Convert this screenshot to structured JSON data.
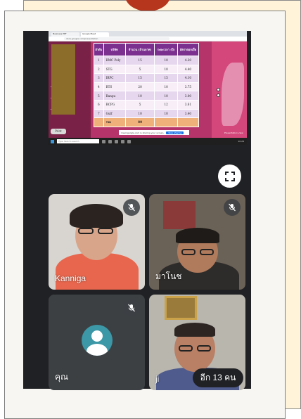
{
  "browser": {
    "tabs": [
      "Business PPT",
      "Google Meet"
    ],
    "url": "docs.google.com/presentation"
  },
  "slide": {
    "left_lines": [
      "...",
      "...",
      "..."
    ],
    "print_button": "Print",
    "table": {
      "headers": [
        "ลำดับ",
        "บริษัท",
        "จำนวน (ล้านบาท)",
        "ระยะเวลา (ปี)",
        "อัตราดอกเบี้ย"
      ],
      "rows": [
        [
          "1",
          "RMC Poly",
          "15",
          "10",
          "4.20"
        ],
        [
          "2",
          "STG",
          "5",
          "10",
          "4.40"
        ],
        [
          "3",
          "IRPC",
          "15",
          "15",
          "4.10"
        ],
        [
          "4",
          "BTS",
          "20",
          "10",
          "3.75"
        ],
        [
          "5",
          "Banpu",
          "10",
          "10",
          "3.00"
        ],
        [
          "6",
          "BCPG",
          "5",
          "12",
          "3.61"
        ],
        [
          "7",
          "Gulf",
          "10",
          "10",
          "3.40"
        ]
      ],
      "total": [
        "",
        "รวม",
        "80",
        "",
        ""
      ]
    }
  },
  "share_banner": {
    "text": "meet.google.com is sharing your screen.",
    "stop_label": "Stop sharing"
  },
  "presentation_label": "Presentation view",
  "taskbar": {
    "search_placeholder": "Type here to search",
    "clock": "10:29"
  },
  "participants": [
    {
      "name": "Kanniga",
      "muted": true
    },
    {
      "name": "มาโนช",
      "muted": true
    },
    {
      "name": "คุณ",
      "muted": true
    },
    {
      "name": "ji",
      "muted": false
    }
  ],
  "more_participants_label": "อีก 13 คน",
  "colors": {
    "meet_bg": "#202124",
    "table_header": "#7b2f8f",
    "slide_bg": "#b5346a",
    "back_card": "#fff3d9",
    "accent_tab": "#b5361c"
  }
}
